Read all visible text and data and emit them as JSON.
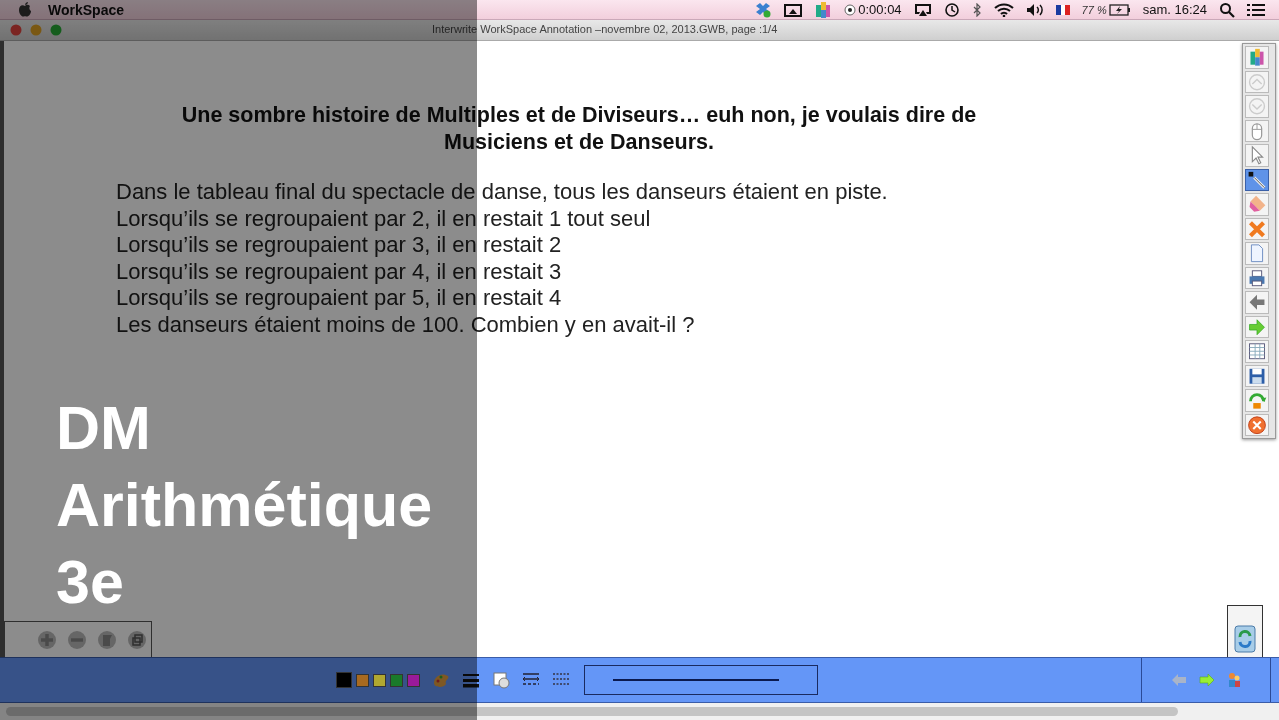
{
  "menubar": {
    "app_name": "WorkSpace",
    "timer": "0:00:04",
    "battery": "77 %",
    "clock": "sam. 16:24"
  },
  "window": {
    "title": "Interwrite WorkSpace Annotation –novembre 02, 2013.GWB, page :1/4"
  },
  "document": {
    "heading": "Une sombre histoire de Multiples et de Diviseurs… euh non, je voulais dire de Musiciens et de Danseurs.",
    "lines": [
      "Dans le tableau final du spectacle de danse, tous les danseurs étaient en piste.",
      "Lorsqu’ils se regroupaient par 2, il en restait 1 tout seul",
      "Lorsqu’ils se regroupaient par 3, il en restait 2",
      "Lorsqu’ils se regroupaient par 4, il en restait 3",
      "Lorsqu’ils se regroupaient par 5, il en restait 4",
      "Les danseurs étaient moins de 100. Combien y en avait-il ?"
    ]
  },
  "tools": [
    {
      "kind": "app",
      "selected": false
    },
    {
      "kind": "up",
      "selected": false
    },
    {
      "kind": "down",
      "selected": false
    },
    {
      "kind": "mouse",
      "selected": false
    },
    {
      "kind": "pointer",
      "selected": false
    },
    {
      "kind": "pen",
      "selected": true
    },
    {
      "kind": "eraser",
      "selected": false
    },
    {
      "kind": "clear",
      "selected": false
    },
    {
      "kind": "page",
      "selected": false
    },
    {
      "kind": "print",
      "selected": false
    },
    {
      "kind": "back",
      "selected": false
    },
    {
      "kind": "forward",
      "selected": false
    },
    {
      "kind": "grid",
      "selected": false
    },
    {
      "kind": "save",
      "selected": false
    },
    {
      "kind": "recycle",
      "selected": false
    },
    {
      "kind": "close",
      "selected": false
    }
  ],
  "swatches": [
    {
      "color": "#000000"
    },
    {
      "color": "#a86a20"
    },
    {
      "color": "#b0a830"
    },
    {
      "color": "#1a7a2a"
    },
    {
      "color": "#9a1a9a"
    }
  ],
  "overlay": {
    "title_lines": [
      "DM",
      "Arithmétique",
      "3e"
    ]
  }
}
